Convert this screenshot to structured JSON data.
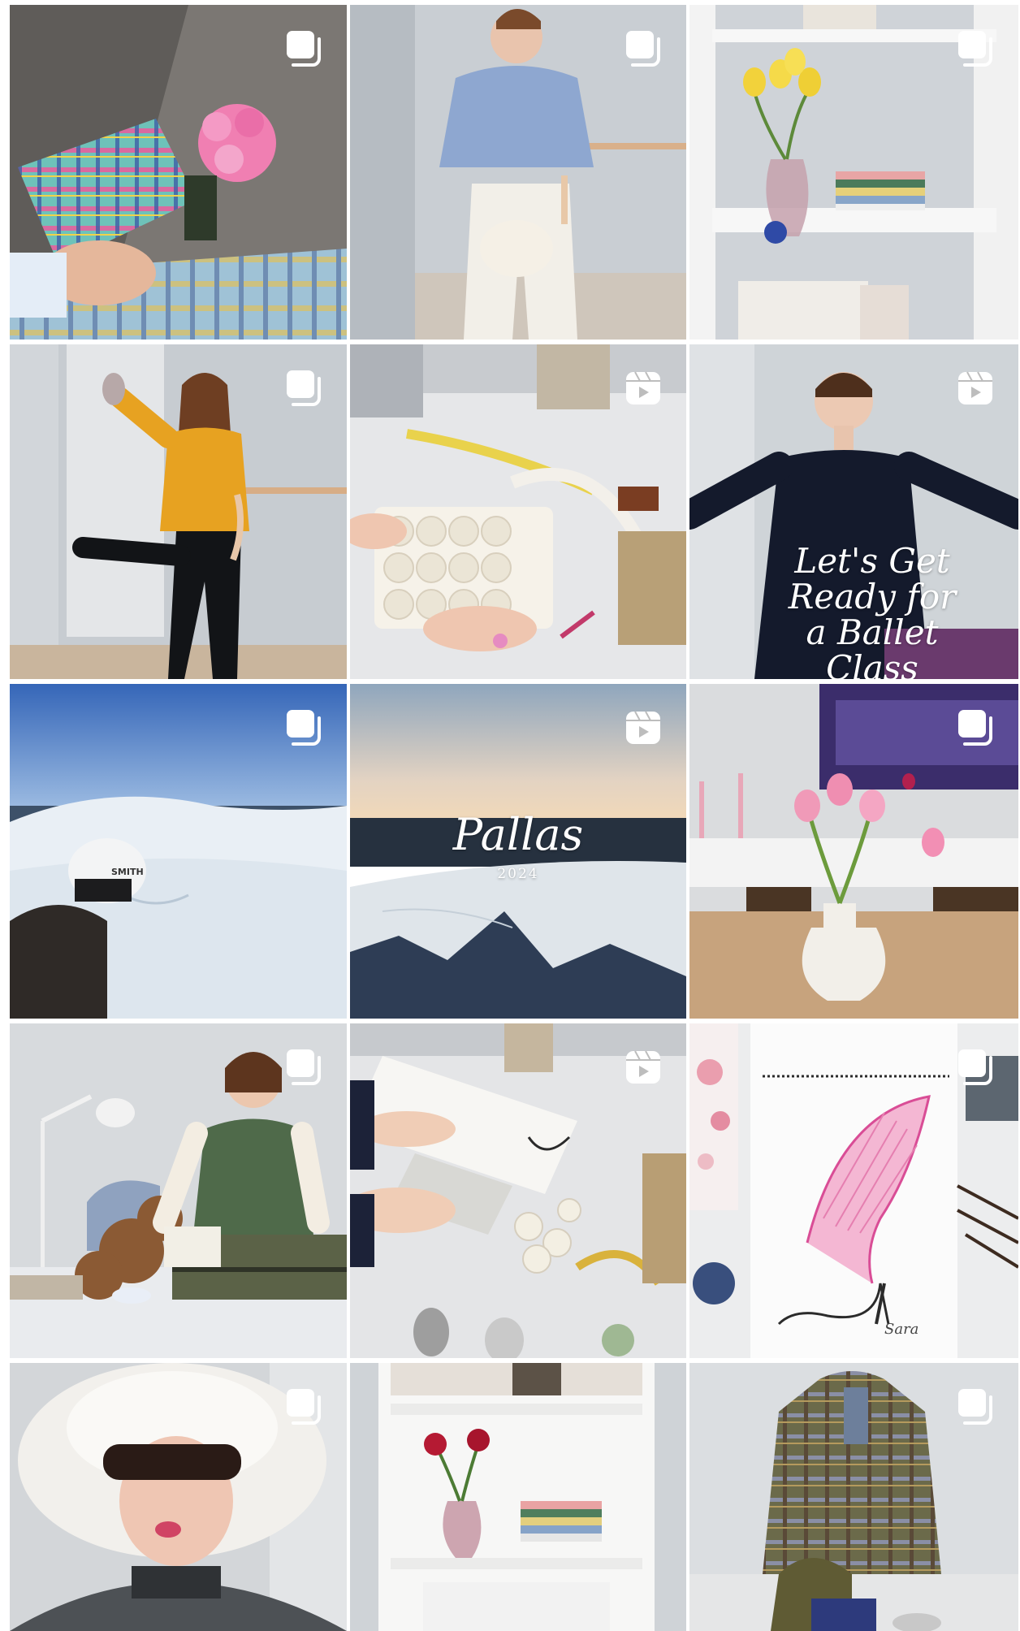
{
  "grid": {
    "posts": [
      {
        "id": 1,
        "type": "carousel",
        "description": "Tartan bag and pink roses"
      },
      {
        "id": 2,
        "type": "carousel",
        "description": "Blue shirt and white trousers"
      },
      {
        "id": 3,
        "type": "carousel",
        "description": "Tulips on white shelf"
      },
      {
        "id": 4,
        "type": "carousel",
        "description": "Yellow blouse at ballet barre"
      },
      {
        "id": 5,
        "type": "reel",
        "description": "Crafting rose-covered bag"
      },
      {
        "id": 6,
        "type": "reel",
        "description": "Ballet class video",
        "overlay_text": "Let's Get\nReady for\na Ballet Class"
      },
      {
        "id": 7,
        "type": "carousel",
        "description": "Ski slope with snowy fells",
        "helmet_text": "SMITH"
      },
      {
        "id": 8,
        "type": "reel",
        "description": "Pallas fells view",
        "overlay_title": "Pallas",
        "overlay_year": "2024"
      },
      {
        "id": 9,
        "type": "carousel",
        "description": "Pink tulips in white vase"
      },
      {
        "id": 10,
        "type": "carousel",
        "description": "Reading with teddy bear"
      },
      {
        "id": 11,
        "type": "reel",
        "description": "Sketchbook and fabric roses"
      },
      {
        "id": 12,
        "type": "carousel",
        "description": "Watercolour shoe sketch",
        "signature": "Sara"
      },
      {
        "id": 13,
        "type": "carousel",
        "description": "Fur hat and sunglasses"
      },
      {
        "id": 14,
        "type": "none",
        "description": "Roses on bookshelf"
      },
      {
        "id": 15,
        "type": "carousel",
        "description": "Tartan jacket on hanger"
      }
    ]
  },
  "colors": {
    "badge": "#ffffff",
    "sky_blue": "#3f73c0",
    "snow": "#e8eef3",
    "wall": "#d6dbe0"
  }
}
